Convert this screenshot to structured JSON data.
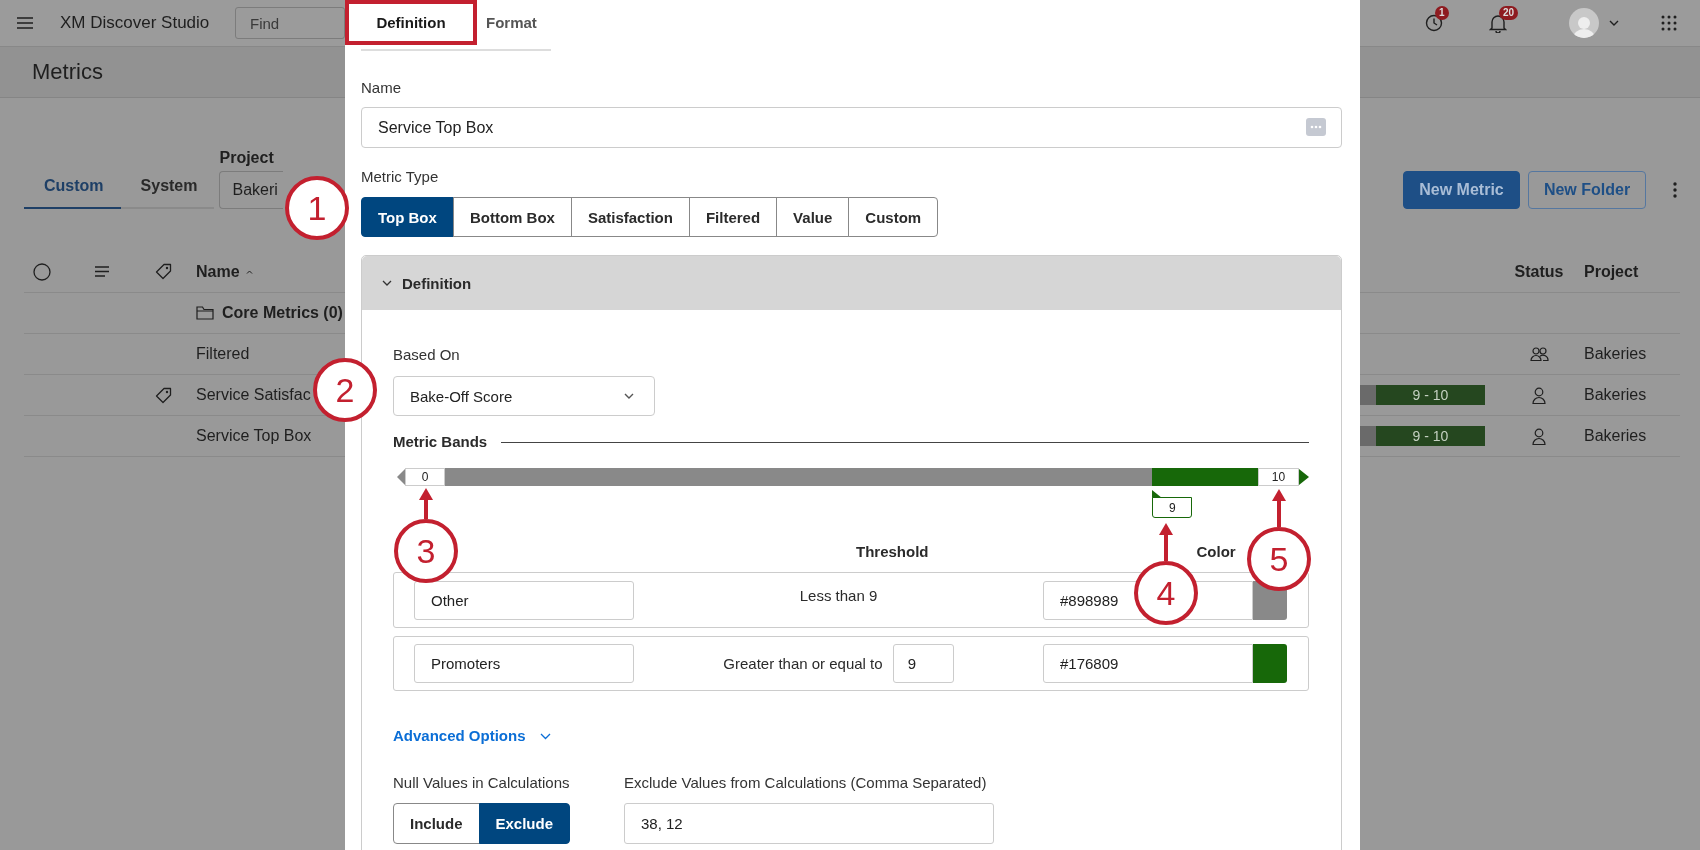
{
  "app_bar": {
    "title": "XM Discover Studio",
    "search": {
      "placeholder": "Find"
    },
    "indicators": [
      {
        "kind": "history",
        "count": "1"
      },
      {
        "kind": "bell",
        "count": "20"
      }
    ]
  },
  "page_title": "Metrics",
  "view_tabs": [
    {
      "label": "Custom",
      "selected": true
    },
    {
      "label": "System",
      "selected": false
    }
  ],
  "project_filter": {
    "label": "Project",
    "value": "Bakeri"
  },
  "actions": [
    {
      "label": "New Metric",
      "kind": "primary"
    },
    {
      "label": "New Folder",
      "kind": "secondary"
    }
  ],
  "table": {
    "columns": [
      {
        "label": "Name"
      },
      {
        "label": "Status"
      },
      {
        "label": "Project"
      }
    ],
    "rows": [
      {
        "kind": "folder",
        "name": "Core Metrics (0)"
      },
      {
        "kind": "metric",
        "name": "Filtered",
        "tagged": false,
        "status": {
          "kind": "shared"
        },
        "project": "Bakeries"
      },
      {
        "kind": "metric",
        "name": "Service Satisfac",
        "tagged": true,
        "band": "9 - 10",
        "status": {
          "kind": "private"
        },
        "project": "Bakeries"
      },
      {
        "kind": "metric",
        "name": "Service Top Box",
        "tagged": false,
        "band": "9 - 10",
        "status": {
          "kind": "private"
        },
        "project": "Bakeries"
      }
    ]
  },
  "modal": {
    "tabs": [
      {
        "label": "Definition",
        "selected": true,
        "highlighted": true
      },
      {
        "label": "Format",
        "selected": false,
        "highlighted": false
      }
    ],
    "name_field": {
      "label": "Name",
      "value": "Service Top Box"
    },
    "metric_type": {
      "label": "Metric Type",
      "options": [
        {
          "label": "Top Box",
          "selected": true
        },
        {
          "label": "Bottom Box",
          "selected": false
        },
        {
          "label": "Satisfaction",
          "selected": false
        },
        {
          "label": "Filtered",
          "selected": false
        },
        {
          "label": "Value",
          "selected": false
        },
        {
          "label": "Custom",
          "selected": false
        }
      ]
    },
    "definition": {
      "title": "Definition",
      "expanded": true,
      "based_on": {
        "label": "Based On",
        "value": "Bake-Off Score"
      },
      "bands": {
        "title": "Metric Bands",
        "min": "0",
        "max": "10",
        "split": "9",
        "level": 0.87,
        "threshold_header": "Threshold",
        "color_header": "Color",
        "rows": [
          {
            "name": "Other",
            "kind": "fixed",
            "threshold": "Less than 9",
            "color": "#898989"
          },
          {
            "name": "Promoters",
            "kind": "editable",
            "threshold": "Greater than or equal to",
            "value": "9",
            "color": "#176809"
          }
        ]
      },
      "advanced": {
        "label": "Advanced Options",
        "expanded": false
      },
      "null_values": {
        "label": "Null Values in Calculations",
        "options": [
          {
            "label": "Include",
            "selected": false
          },
          {
            "label": "Exclude",
            "selected": true
          }
        ]
      },
      "exclude_values": {
        "label": "Exclude Values from Calculations (Comma Separated)",
        "value": "38, 12"
      }
    }
  },
  "callouts": [
    {
      "number": "1"
    },
    {
      "number": "2"
    },
    {
      "number": "3"
    },
    {
      "number": "4"
    },
    {
      "number": "5"
    }
  ]
}
